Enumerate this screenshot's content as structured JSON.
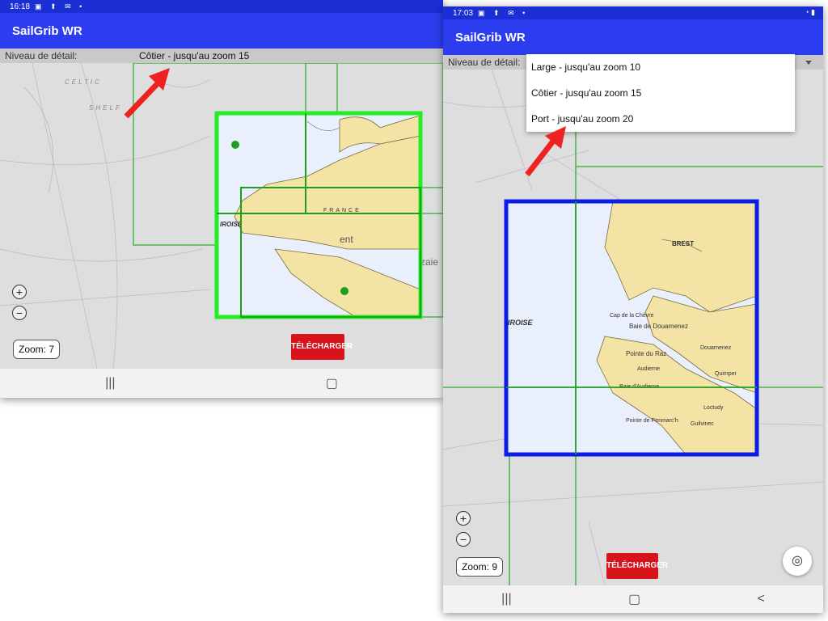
{
  "left_screen": {
    "status_time": "16:18",
    "app_title": "SailGrib WR",
    "detail_label": "Niveau de détail:",
    "detail_value": "Côtier - jusqu'au zoom 15",
    "zoom_in": "+",
    "zoom_out": "−",
    "zoom_label": "Zoom: 7",
    "download_label": "TÉLÉCHARGER",
    "nav": [
      "|||",
      "▢"
    ],
    "map_text": [
      "CELTIC",
      "SHELF",
      "IROISE",
      "FRANCE",
      "ent",
      "zaie"
    ],
    "selection_color": "#22ee22"
  },
  "right_screen": {
    "status_time": "17:03",
    "app_title": "SailGrib WR",
    "detail_label": "Niveau de détail:",
    "menu_items": [
      "Large - jusqu'au zoom 10",
      "Côtier - jusqu'au zoom 15",
      "Port - jusqu'au zoom 20"
    ],
    "zoom_in": "+",
    "zoom_out": "−",
    "zoom_label": "Zoom: 9",
    "download_label": "TÉLÉCHARGER",
    "nav": [
      "|||",
      "▢",
      "<"
    ],
    "map_text": [
      "BREST",
      "IROISE",
      "Baie de Douarnenez",
      "Douarnenez",
      "Pointe du Raz",
      "Audierne",
      "Quimper",
      "Cap de la Chèvre",
      "Baie d'Audierne",
      "Pointe de Penmarc'h",
      "Loctudy",
      "Guilvinec"
    ],
    "selection_color": "#0a1ee6"
  },
  "annotation_color": "#ee2222"
}
